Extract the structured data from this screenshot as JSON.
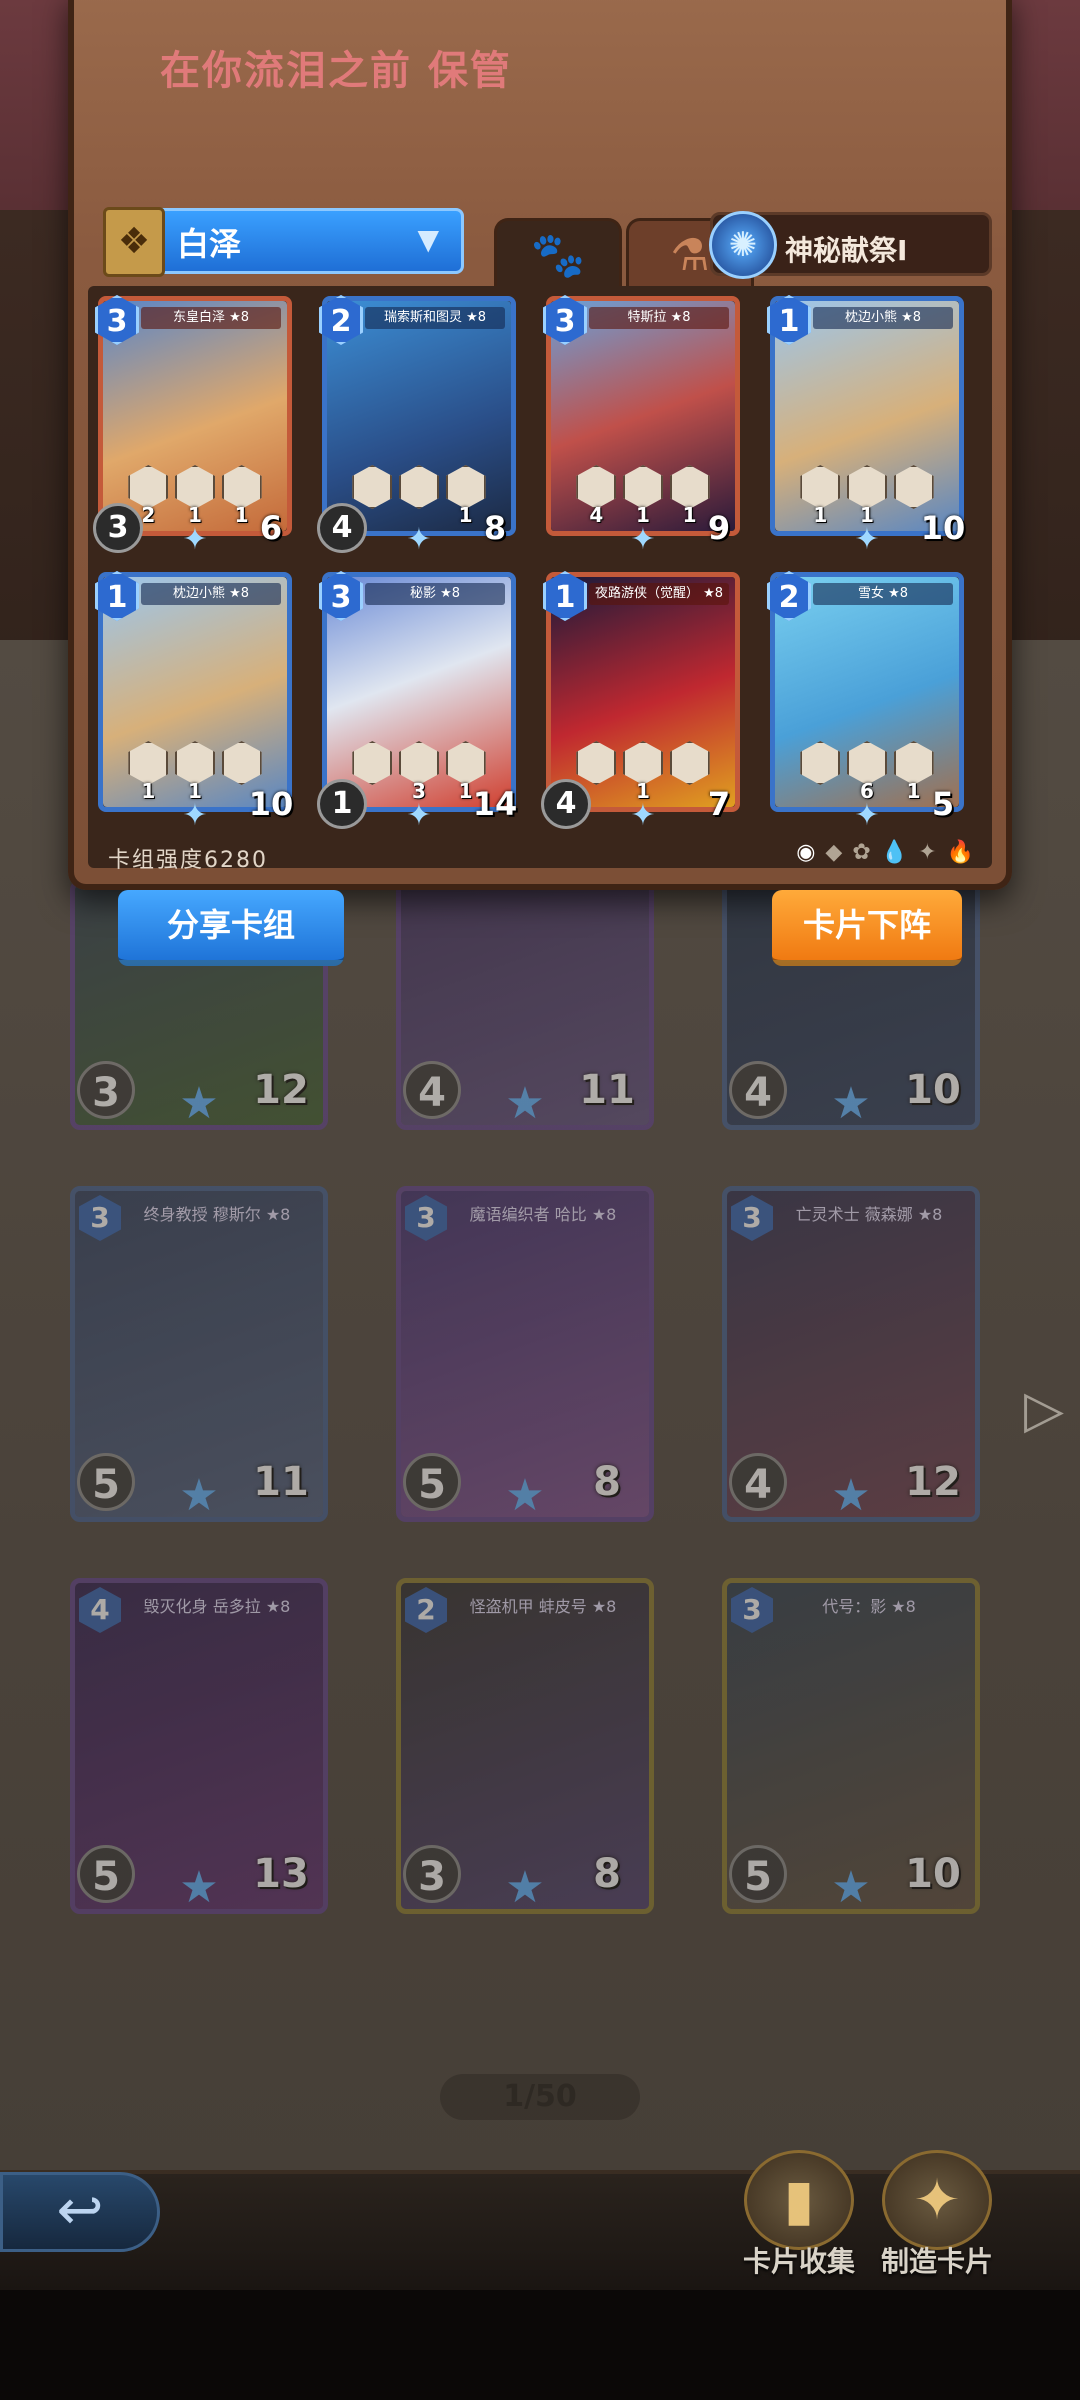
{
  "deck": {
    "title": "在你流泪之前 保管",
    "selected_hero": "白泽",
    "ritual": "神秘献祭I",
    "strength_label": "卡组强度",
    "strength_value": "6280",
    "cards": [
      {
        "name": "东皇白泽 ★8",
        "cost": "3",
        "attack": "3",
        "health": "6",
        "tokens": [
          "2",
          "1",
          "1"
        ],
        "color": "red"
      },
      {
        "name": "瑞索斯和图灵 ★8",
        "cost": "2",
        "attack": "4",
        "health": "8",
        "tokens": [
          "",
          "",
          "1"
        ],
        "color": "blue"
      },
      {
        "name": "特斯拉 ★8",
        "cost": "3",
        "attack": "",
        "health": "9",
        "tokens": [
          "4",
          "1",
          "1"
        ],
        "color": "red"
      },
      {
        "name": "枕边小熊 ★8",
        "cost": "1",
        "attack": "",
        "health": "10",
        "tokens": [
          "1",
          "1",
          ""
        ],
        "color": "blue"
      },
      {
        "name": "枕边小熊 ★8",
        "cost": "1",
        "attack": "",
        "health": "10",
        "tokens": [
          "1",
          "1",
          ""
        ],
        "color": "blue"
      },
      {
        "name": "秘影 ★8",
        "cost": "3",
        "attack": "1",
        "health": "14",
        "tokens": [
          "",
          "3",
          "1"
        ],
        "color": "blue"
      },
      {
        "name": "夜路游侠（觉醒） ★8",
        "cost": "1",
        "attack": "4",
        "health": "7",
        "tokens": [
          "",
          "1",
          ""
        ],
        "color": "red"
      },
      {
        "name": "雪女 ★8",
        "cost": "2",
        "attack": "",
        "health": "5",
        "tokens": [
          "",
          "6",
          "1"
        ],
        "color": "blue"
      }
    ]
  },
  "buttons": {
    "share": "分享卡组",
    "unequip": "卡片下阵"
  },
  "collection": {
    "cards": [
      {
        "name": "",
        "cost": "",
        "attack": "3",
        "health": "12",
        "color": "purple",
        "partial": true
      },
      {
        "name": "",
        "cost": "",
        "attack": "4",
        "health": "11",
        "color": "purple",
        "partial": true
      },
      {
        "name": "",
        "cost": "",
        "attack": "4",
        "health": "10",
        "color": "blue",
        "partial": true
      },
      {
        "name": "终身教授 穆斯尔 ★8",
        "cost": "3",
        "attack": "5",
        "health": "11",
        "color": "blue"
      },
      {
        "name": "魔语编织者 哈比 ★8",
        "cost": "3",
        "attack": "5",
        "health": "8",
        "color": "purple"
      },
      {
        "name": "亡灵术士 薇森娜 ★8",
        "cost": "3",
        "attack": "4",
        "health": "12",
        "color": "blue"
      },
      {
        "name": "毁灭化身 岳多拉 ★8",
        "cost": "4",
        "attack": "5",
        "health": "13",
        "color": "purple"
      },
      {
        "name": "怪盗机甲 蚌皮号 ★8",
        "cost": "2",
        "attack": "3",
        "health": "8",
        "color": "yellow"
      },
      {
        "name": "代号：影 ★8",
        "cost": "3",
        "attack": "5",
        "health": "10",
        "color": "yellow"
      }
    ],
    "page": "1/50"
  },
  "nav": {
    "collection_label": "卡片收集",
    "craft_label": "制造卡片"
  },
  "colors": {
    "card_blue": "#3a73c9",
    "card_red": "#c45a3a",
    "share_button": "#2f8ef0",
    "unequip_button": "#f7921f"
  }
}
